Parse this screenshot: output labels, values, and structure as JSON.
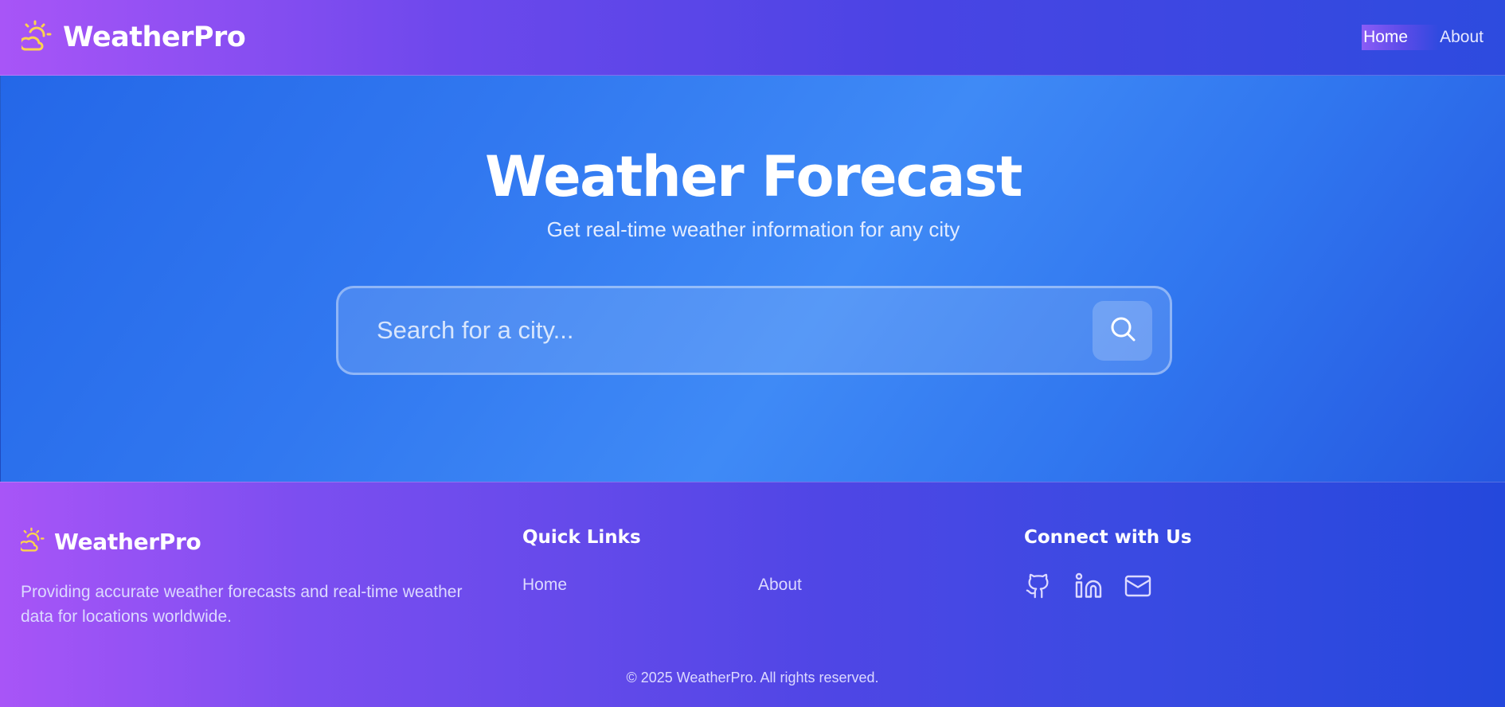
{
  "nav": {
    "brand": "WeatherPro",
    "links": [
      {
        "label": "Home"
      },
      {
        "label": "About"
      }
    ]
  },
  "hero": {
    "title": "Weather Forecast",
    "subtitle": "Get real-time weather information for any city",
    "search": {
      "placeholder": "Search for a city...",
      "value": ""
    }
  },
  "footer": {
    "brand": "WeatherPro",
    "description": "Providing accurate weather forecasts and real-time weather data for locations worldwide.",
    "quick_links": {
      "heading": "Quick Links",
      "items": [
        {
          "label": "Home"
        },
        {
          "label": "About"
        }
      ]
    },
    "connect": {
      "heading": "Connect with Us",
      "icons": [
        "github-icon",
        "linkedin-icon",
        "mail-icon"
      ]
    },
    "copyright": "© 2025 WeatherPro. All rights reserved."
  },
  "colors": {
    "sun_accent": "#fcd34d",
    "gradient_start": "#a855f7",
    "gradient_end": "#2448dc",
    "hero_blue": "#3b82f6"
  }
}
